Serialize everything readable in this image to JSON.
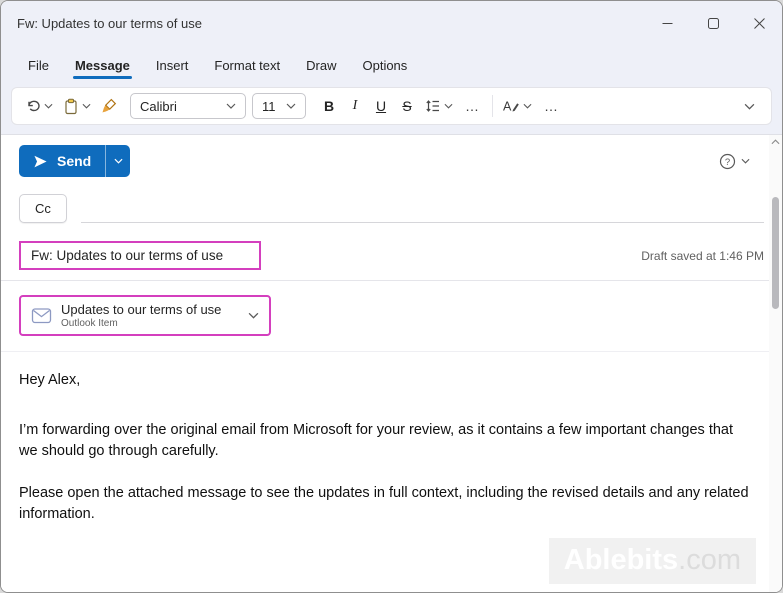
{
  "window": {
    "title": "Fw: Updates to our terms of use"
  },
  "menu": {
    "tabs": [
      {
        "label": "File"
      },
      {
        "label": "Message"
      },
      {
        "label": "Insert"
      },
      {
        "label": "Format text"
      },
      {
        "label": "Draw"
      },
      {
        "label": "Options"
      }
    ]
  },
  "toolbar": {
    "font_name": "Calibri",
    "font_size": "11",
    "bold": "B",
    "italic": "I",
    "underline": "U",
    "strikethrough": "S",
    "ellipsis": "…"
  },
  "compose": {
    "send_label": "Send",
    "cc_label": "Cc",
    "subject": "Fw: Updates to our terms of use",
    "draft_status": "Draft saved at 1:46 PM",
    "attachment": {
      "title": "Updates to our terms of use",
      "subtitle": "Outlook Item"
    },
    "body": {
      "greeting": "Hey Alex,",
      "paragraph1": "I’m forwarding over the original email from Microsoft for your review, as it contains a few important changes that we should go through carefully.",
      "paragraph2": "Please open the attached message to see the updates in full context, including the revised details and any related information."
    }
  },
  "watermark": {
    "name": "Ablebits",
    "suffix": ".com"
  },
  "colors": {
    "accent": "#0f6cbd",
    "annotation": "#d43fbe",
    "titlebar": "#eef0f8"
  }
}
